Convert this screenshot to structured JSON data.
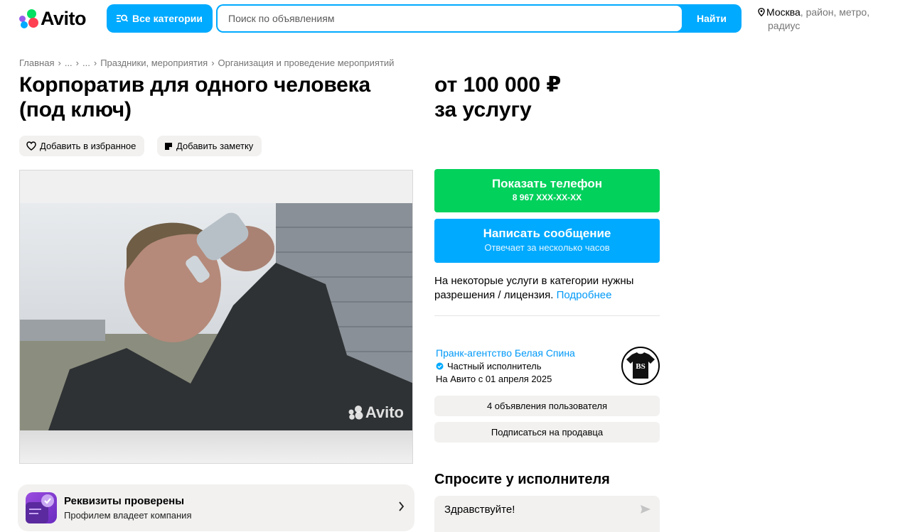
{
  "header": {
    "logo_text": "Avito",
    "categories_button": "Все категории",
    "search_placeholder": "Поиск по объявлениям",
    "search_button": "Найти",
    "location_city": "Москва",
    "location_rest": ", район, метро,",
    "location_radius": "радиус"
  },
  "breadcrumb": [
    "Главная",
    "...",
    "...",
    "Праздники, мероприятия",
    "Организация и проведение мероприятий"
  ],
  "listing": {
    "title": "Корпоратив для одного человека (под ключ)",
    "price_line1": "от 100 000 ₽",
    "price_line2": "за услугу",
    "favorite_label": "Добавить в избранное",
    "note_label": "Добавить заметку",
    "photo_watermark": "Avito"
  },
  "requisites": {
    "title": "Реквизиты проверены",
    "subtitle": "Профилем владеет компания"
  },
  "contact": {
    "phone_button": "Показать телефон",
    "phone_masked": "8 967 XXX-XX-XX",
    "message_button": "Написать сообщение",
    "message_sub": "Отвечает за несколько часов"
  },
  "license": {
    "text": "На некоторые услуги в категории нужны разрешения / лицензия.",
    "link": "Подробнее"
  },
  "seller": {
    "name": "Пранк-агентство Белая Спина",
    "type": "Частный исполнитель",
    "since": "На Авито с 01 апреля 2025",
    "avatar_letters": "BS",
    "listings_button": "4 объявления пользователя",
    "subscribe_button": "Подписаться на продавца"
  },
  "ask": {
    "title": "Спросите у исполнителя",
    "message": "Здравствуйте!"
  },
  "colors": {
    "brand_blue": "#00aaff",
    "phone_green": "#02d15c",
    "link_blue": "#0099f7",
    "chip_gray": "#f2f1f0"
  }
}
